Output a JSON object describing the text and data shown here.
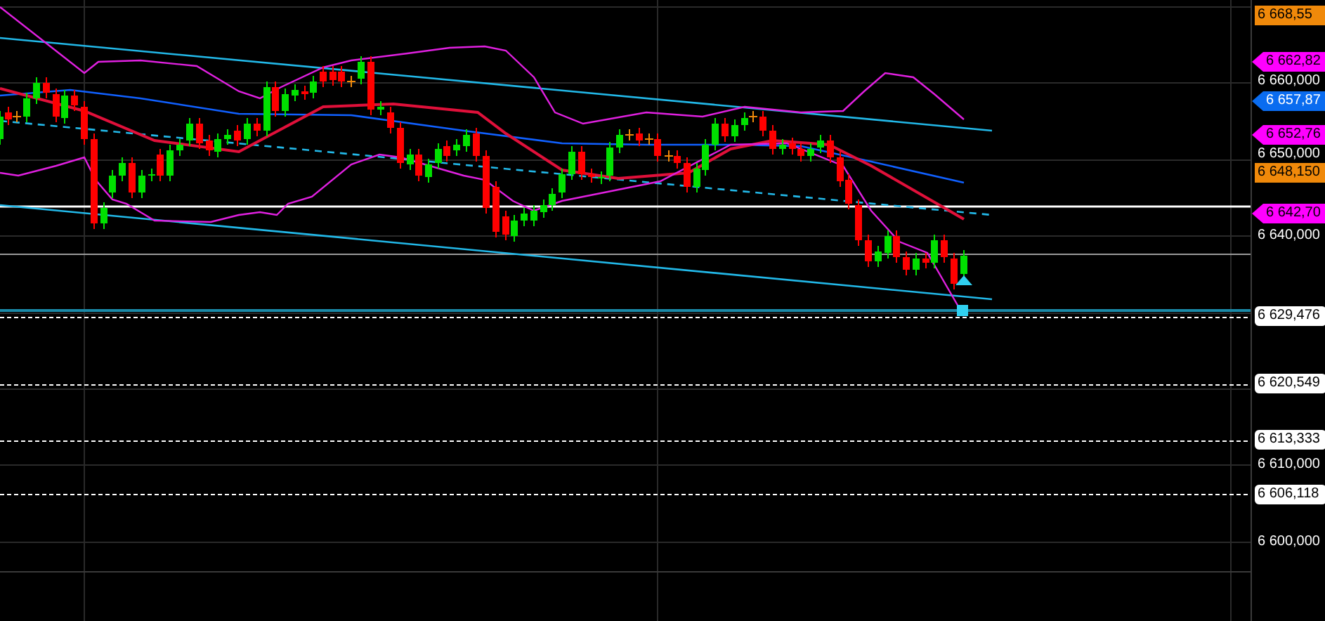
{
  "chart": {
    "price_axis_labels": [
      "6 660,000",
      "6 650,000",
      "6 640,000",
      "6 610,000",
      "6 600,000"
    ],
    "price_tags": [
      {
        "text": "6 668,55",
        "kind": "level",
        "color": "#f0890a"
      },
      {
        "text": "6 662,82",
        "kind": "marker",
        "color": "#ff00ff"
      },
      {
        "text": "6 657,87",
        "kind": "marker",
        "color": "#0a6cf0"
      },
      {
        "text": "6 652,76",
        "kind": "marker",
        "color": "#ff00ff"
      },
      {
        "text": "6 648,150",
        "kind": "level",
        "color": "#f0890a"
      },
      {
        "text": "6 642,70",
        "kind": "marker",
        "color": "#ff00ff"
      },
      {
        "text": "6 629,476",
        "kind": "line",
        "color": "#ffffff"
      },
      {
        "text": "6 620,549",
        "kind": "line",
        "color": "#ffffff"
      },
      {
        "text": "6 613,333",
        "kind": "line",
        "color": "#ffffff"
      },
      {
        "text": "6 606,118",
        "kind": "line",
        "color": "#ffffff"
      }
    ]
  }
}
